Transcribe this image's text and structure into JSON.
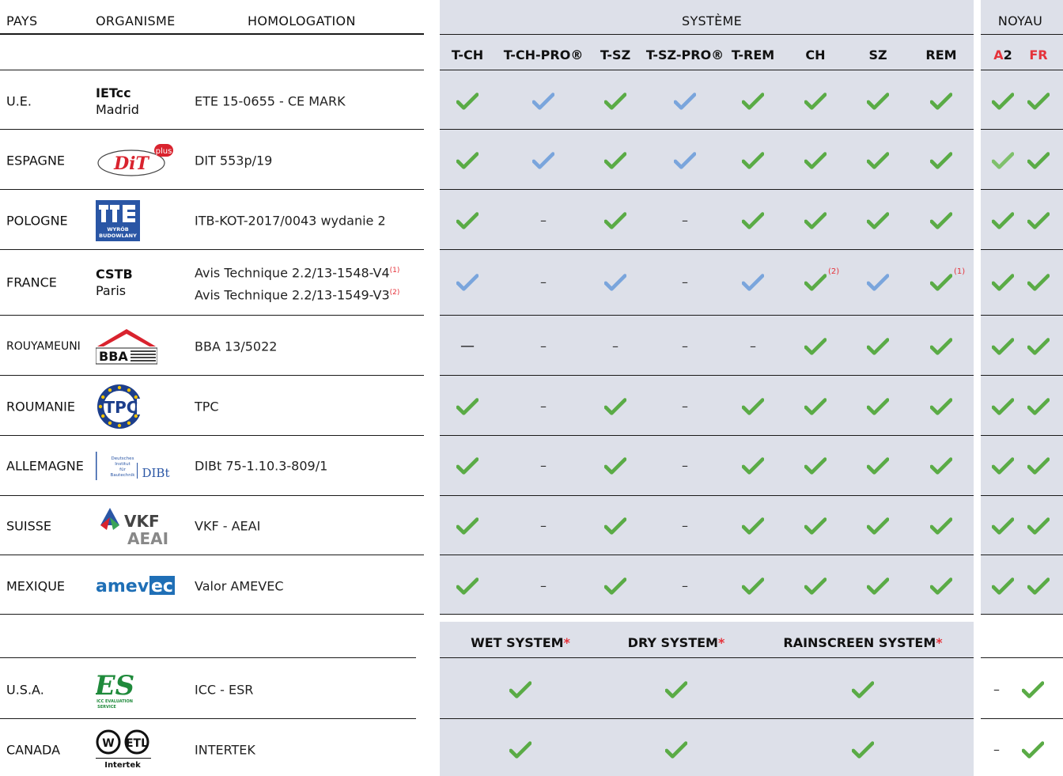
{
  "colors": {
    "green": "#5aab46",
    "blue": "#7aa5dc",
    "red": "#e5333b",
    "panel": "#dde0e9"
  },
  "headers": {
    "pays": "PAYS",
    "organisme": "ORGANISME",
    "homologation": "HOMOLOGATION",
    "systeme": "SYSTÈME",
    "noyau": "NOYAU"
  },
  "system_columns": [
    "T-CH",
    "T-CH-PRO®",
    "T-SZ",
    "T-SZ-PRO®",
    "T-REM",
    "CH",
    "SZ",
    "REM"
  ],
  "noyau_columns": [
    {
      "prefix": "A",
      "suffix": "2"
    },
    {
      "prefix": "FR",
      "suffix": ""
    }
  ],
  "legend": {
    "green": "check",
    "blue": "check",
    "dash": "—"
  },
  "rows": [
    {
      "pays": "U.E.",
      "org_bold": "IETcc",
      "org_sub": "Madrid",
      "org_logo": "",
      "homologation": [
        "ETE 15-0655 - CE MARK"
      ],
      "hom_notes": [
        ""
      ],
      "systeme": [
        "G",
        "B",
        "G",
        "B",
        "G",
        "G",
        "G",
        "G"
      ],
      "notes": [
        "",
        "",
        "",
        "",
        "",
        "",
        "",
        ""
      ],
      "noyau": [
        "G",
        "G"
      ]
    },
    {
      "pays": "ESPAGNE",
      "org_bold": "",
      "org_sub": "",
      "org_logo": "dit-plus-logo",
      "logo_text": "DiT",
      "logo_badge": "plus",
      "homologation": [
        "DIT 553p/19"
      ],
      "hom_notes": [
        ""
      ],
      "systeme": [
        "G",
        "B",
        "G",
        "B",
        "G",
        "G",
        "G",
        "G"
      ],
      "notes": [
        "",
        "",
        "",
        "",
        "",
        "",
        "",
        ""
      ],
      "noyau": [
        "L",
        "G"
      ]
    },
    {
      "pays": "POLOGNE",
      "org_bold": "",
      "org_sub": "",
      "org_logo": "itb-logo",
      "logo_text": "WYRÓB BUDOWLANY",
      "homologation": [
        "ITB-KOT-2017/0043 wydanie 2"
      ],
      "hom_notes": [
        ""
      ],
      "systeme": [
        "G",
        "D",
        "G",
        "D",
        "G",
        "G",
        "G",
        "G"
      ],
      "notes": [
        "",
        "",
        "",
        "",
        "",
        "",
        "",
        ""
      ],
      "noyau": [
        "G",
        "G"
      ]
    },
    {
      "pays": "FRANCE",
      "org_bold": "CSTB",
      "org_sub": "Paris",
      "org_logo": "",
      "homologation": [
        "Avis Technique 2.2/13-1548-V4",
        "Avis Technique 2.2/13-1549-V3"
      ],
      "hom_notes": [
        "(1)",
        "(2)"
      ],
      "systeme": [
        "B",
        "D",
        "B",
        "D",
        "B",
        "G",
        "B",
        "G"
      ],
      "notes": [
        "",
        "",
        "",
        "",
        "",
        "(2)",
        "",
        "(1)"
      ],
      "noyau": [
        "G",
        "G"
      ]
    },
    {
      "pays": "ROUYAMEUNI",
      "org_bold": "",
      "org_sub": "",
      "org_logo": "bba-logo",
      "logo_text": "BBA",
      "homologation": [
        "BBA 13/5022"
      ],
      "hom_notes": [
        ""
      ],
      "systeme": [
        "X",
        "D",
        "D",
        "D",
        "D",
        "G",
        "G",
        "G"
      ],
      "notes": [
        "",
        "",
        "",
        "",
        "",
        "",
        "",
        ""
      ],
      "noyau": [
        "G",
        "G"
      ]
    },
    {
      "pays": "ROUMANIE",
      "org_bold": "",
      "org_sub": "",
      "org_logo": "tpc-logo",
      "logo_text": "TPC",
      "homologation": [
        "TPC"
      ],
      "hom_notes": [
        ""
      ],
      "systeme": [
        "G",
        "D",
        "G",
        "D",
        "G",
        "G",
        "G",
        "G"
      ],
      "notes": [
        "",
        "",
        "",
        "",
        "",
        "",
        "",
        ""
      ],
      "noyau": [
        "G",
        "G"
      ]
    },
    {
      "pays": "ALLEMAGNE",
      "org_bold": "",
      "org_sub": "",
      "org_logo": "dibt-logo",
      "logo_text": "DIBt",
      "logo_small": "Deutsches Institut für Bautechnik",
      "homologation": [
        "DIBt 75-1.10.3-809/1"
      ],
      "hom_notes": [
        ""
      ],
      "systeme": [
        "G",
        "D",
        "G",
        "D",
        "G",
        "G",
        "G",
        "G"
      ],
      "notes": [
        "",
        "",
        "",
        "",
        "",
        "",
        "",
        ""
      ],
      "noyau": [
        "G",
        "G"
      ]
    },
    {
      "pays": "SUISSE",
      "org_bold": "",
      "org_sub": "",
      "org_logo": "vkf-logo",
      "logo_text": "VKF",
      "logo_text2": "AEAI",
      "homologation": [
        "VKF - AEAI"
      ],
      "hom_notes": [
        ""
      ],
      "systeme": [
        "G",
        "D",
        "G",
        "D",
        "G",
        "G",
        "G",
        "G"
      ],
      "notes": [
        "",
        "",
        "",
        "",
        "",
        "",
        "",
        ""
      ],
      "noyau": [
        "G",
        "G"
      ]
    },
    {
      "pays": "MEXIQUE",
      "org_bold": "",
      "org_sub": "",
      "org_logo": "amevec-logo",
      "logo_text": "amev",
      "logo_text2": "ec",
      "homologation": [
        "Valor AMEVEC"
      ],
      "hom_notes": [
        ""
      ],
      "systeme": [
        "G",
        "D",
        "G",
        "D",
        "G",
        "G",
        "G",
        "G"
      ],
      "notes": [
        "",
        "",
        "",
        "",
        "",
        "",
        "",
        ""
      ],
      "noyau": [
        "G",
        "G"
      ]
    }
  ],
  "na_columns": [
    {
      "label": "WET SYSTEM",
      "mark": "*"
    },
    {
      "label": "DRY SYSTEM",
      "mark": "*"
    },
    {
      "label": "RAINSCREEN SYSTEM",
      "mark": "*"
    }
  ],
  "na_rows": [
    {
      "pays": "U.S.A.",
      "org_logo": "icc-es-logo",
      "logo_text": "ES",
      "logo_small": "ICC EVALUATION SERVICE",
      "homologation": "ICC - ESR",
      "systems": [
        "G",
        "G",
        "G"
      ],
      "noyau": [
        "D",
        "G"
      ]
    },
    {
      "pays": "CANADA",
      "org_logo": "intertek-logo",
      "logo_text": "Intertek",
      "homologation": "INTERTEK",
      "systems": [
        "G",
        "G",
        "G"
      ],
      "noyau": [
        "D",
        "G"
      ]
    }
  ]
}
